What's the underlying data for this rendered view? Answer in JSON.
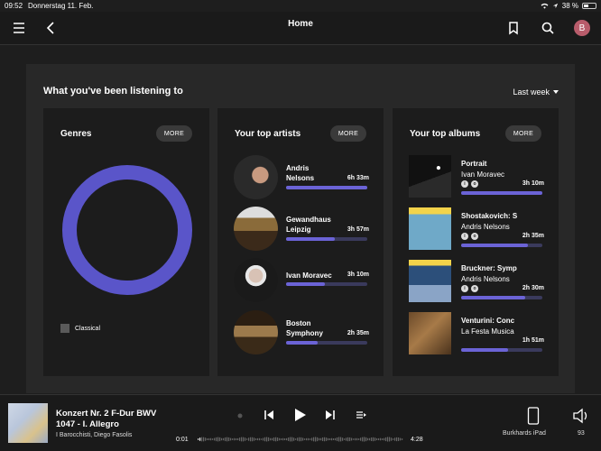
{
  "status": {
    "time": "09:52",
    "date": "Donnerstag 11. Feb.",
    "battery": "38 %",
    "battery_level": 0.38
  },
  "header": {
    "title": "Home",
    "avatar_letter": "B"
  },
  "dashboard": {
    "title": "What you've been listening to",
    "period": "Last week",
    "genres": {
      "title": "Genres",
      "more_label": "MORE",
      "legend": "Classical",
      "color": "#5a55c9"
    },
    "artists": {
      "title": "Your top artists",
      "more_label": "MORE",
      "items": [
        {
          "name_1": "Andris",
          "name_2": "Nelsons",
          "time": "6h 33m",
          "fill": 1.0
        },
        {
          "name_1": "Gewandhaus",
          "name_2": "Leipzig",
          "time": "3h 57m",
          "fill": 0.6
        },
        {
          "name_1": "Ivan Moravec",
          "name_2": "",
          "time": "3h 10m",
          "fill": 0.48
        },
        {
          "name_1": "Boston",
          "name_2": "Symphony",
          "time": "2h 35m",
          "fill": 0.39
        }
      ]
    },
    "albums": {
      "title": "Your top albums",
      "more_label": "MORE",
      "items": [
        {
          "title": "Portrait",
          "artist": "Ivan Moravec",
          "time": "3h 10m",
          "fill": 1.0
        },
        {
          "title": "Shostakovich: S",
          "artist": "Andris Nelsons",
          "time": "2h 35m",
          "fill": 0.82
        },
        {
          "title": "Bruckner: Symp",
          "artist": "Andris Nelsons",
          "time": "2h 30m",
          "fill": 0.79
        },
        {
          "title": "Venturini: Conc",
          "artist": "La Festa Musica",
          "time": "1h 51m",
          "fill": 0.58
        }
      ]
    }
  },
  "player": {
    "title": "Konzert Nr. 2 F-Dur BWV 1047 - I. Allegro",
    "artist": "I Barocchisti, Diego Fasolis",
    "elapsed": "0:01",
    "duration": "4:28",
    "device": "Burkhards iPad",
    "volume": "93"
  }
}
